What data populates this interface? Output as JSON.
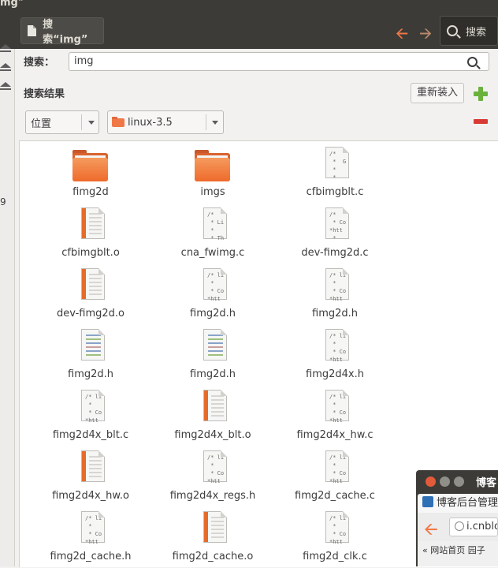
{
  "window": {
    "title": "mg\""
  },
  "toolbar": {
    "tab_label": "搜索“img”",
    "search_button": "搜索"
  },
  "leftpane": {
    "number": "9"
  },
  "search": {
    "label": "搜索：",
    "value": "img"
  },
  "results": {
    "title": "搜索结果",
    "reload_label": "重新装入",
    "location_label": "位置",
    "location_value": "linux-3.5"
  },
  "files": [
    {
      "name": "fimg2d",
      "kind": "folder"
    },
    {
      "name": "imgs",
      "kind": "folder"
    },
    {
      "name": "cfbimgblt.c",
      "kind": "text",
      "code": "/*   \n *  G\n *   \n *   "
    },
    {
      "name": "cfbimgblt.o",
      "kind": "object"
    },
    {
      "name": "cna_fwimg.c",
      "kind": "text",
      "code": "/*   \n * Li\n *   \n * Th"
    },
    {
      "name": "dev-fimg2d.c",
      "kind": "text",
      "code": "/*   \n * Co\n*htt\n *   "
    },
    {
      "name": "dev-fimg2d.o",
      "kind": "object"
    },
    {
      "name": "fimg2d.h",
      "kind": "text",
      "code": "/* li\n *   \n * Co\n*htt"
    },
    {
      "name": "fimg2d.h",
      "kind": "text",
      "code": "/* li\n *   \n * Co\n*htt"
    },
    {
      "name": "fimg2d.h",
      "kind": "colored"
    },
    {
      "name": "fimg2d.h",
      "kind": "colored"
    },
    {
      "name": "fimg2d4x.h",
      "kind": "text",
      "code": "/* li\n *   \n * Co\n*htt"
    },
    {
      "name": "fimg2d4x_blt.c",
      "kind": "text",
      "code": "/* li\n *   \n * Co\n*htt"
    },
    {
      "name": "fimg2d4x_blt.o",
      "kind": "object"
    },
    {
      "name": "fimg2d4x_hw.c",
      "kind": "text",
      "code": "/* li\n *   \n * Co\n*htt"
    },
    {
      "name": "fimg2d4x_hw.o",
      "kind": "object"
    },
    {
      "name": "fimg2d4x_regs.h",
      "kind": "text",
      "code": "/* li\n *   \n * Co\n*htt"
    },
    {
      "name": "fimg2d_cache.c",
      "kind": "text",
      "code": "/* li\n *   \n * Co\n*htt"
    },
    {
      "name": "fimg2d_cache.h",
      "kind": "text",
      "code": "/* li\n *   \n * Co\n*htt"
    },
    {
      "name": "fimg2d_cache.o",
      "kind": "object"
    },
    {
      "name": "fimg2d_clk.c",
      "kind": "text",
      "code": "/* li\n *   \n * Co\n*htt"
    }
  ],
  "popup": {
    "title": "博客",
    "tab": "博客后台管理",
    "url": "i.cnblogs",
    "bookmarks": "« 网站首页  园子"
  },
  "colors": {
    "accent": "#f07746",
    "plus": "#6ab23c",
    "minus": "#d83b35",
    "titlebar": "#3c3b37"
  }
}
